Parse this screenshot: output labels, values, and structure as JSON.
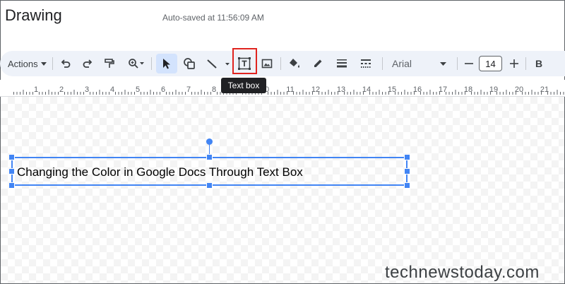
{
  "header": {
    "title": "Drawing",
    "autosave": "Auto-saved at 11:56:09 AM"
  },
  "toolbar": {
    "actions_label": "Actions",
    "tools": [
      {
        "name": "undo-icon"
      },
      {
        "name": "redo-icon"
      },
      {
        "name": "paint-format-icon"
      },
      {
        "name": "zoom-icon"
      },
      {
        "name": "select-icon",
        "selected": true
      },
      {
        "name": "shape-icon"
      },
      {
        "name": "line-icon"
      },
      {
        "name": "text-box-icon",
        "highlighted": true
      },
      {
        "name": "image-icon"
      },
      {
        "name": "fill-color-icon"
      },
      {
        "name": "border-color-icon"
      },
      {
        "name": "border-weight-icon"
      },
      {
        "name": "border-dash-icon"
      }
    ],
    "font": "Arial",
    "font_size": "14",
    "bold_label": "B"
  },
  "tooltip": "Text box",
  "ruler": {
    "numbers": [
      "1",
      "2",
      "3",
      "4",
      "5",
      "6",
      "7",
      "8",
      "9",
      "10",
      "11",
      "12",
      "13",
      "14",
      "15",
      "16",
      "17",
      "18",
      "19",
      "20",
      "21"
    ]
  },
  "canvas": {
    "text_box_content": "Changing the Color in Google Docs Through Text Box"
  },
  "watermark": "technewstoday.com",
  "colors": {
    "toolbar_bg": "#eef2f9",
    "selection": "#4285f4",
    "highlight": "#e0241f",
    "selected_tool_bg": "#d3e3fd"
  }
}
